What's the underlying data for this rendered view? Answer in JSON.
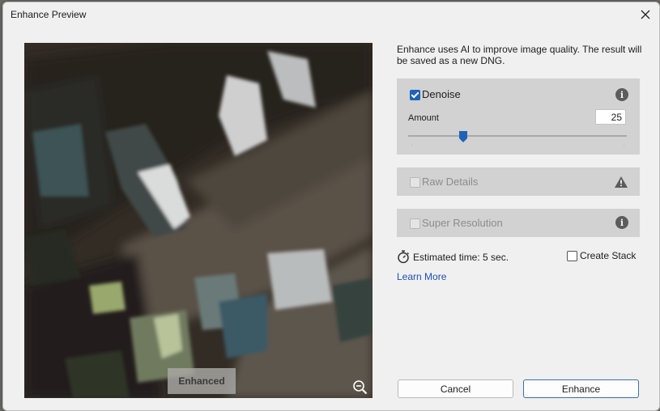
{
  "window": {
    "title": "Enhance Preview"
  },
  "preview": {
    "badge": "Enhanced"
  },
  "description": "Enhance uses AI to improve image quality. The result will be saved as a new DNG.",
  "denoise": {
    "label": "Denoise",
    "checked": true,
    "amount_label": "Amount",
    "amount_value": "25",
    "slider_fraction": 0.25
  },
  "raw_details": {
    "label": "Raw Details",
    "checked": false,
    "enabled": false
  },
  "super_resolution": {
    "label": "Super Resolution",
    "checked": false,
    "enabled": false
  },
  "estimate": {
    "text": "Estimated time: 5 sec."
  },
  "create_stack": {
    "label": "Create Stack",
    "checked": false
  },
  "learn_more": "Learn More",
  "buttons": {
    "cancel": "Cancel",
    "enhance": "Enhance"
  },
  "icons": {
    "close": "close-icon",
    "info": "info-icon",
    "warning": "warning-icon",
    "timer": "stopwatch-icon",
    "zoom": "zoom-out-icon"
  },
  "colors": {
    "accent": "#1e63b8",
    "link": "#1e4fb0",
    "panel": "#d2d2d2"
  }
}
